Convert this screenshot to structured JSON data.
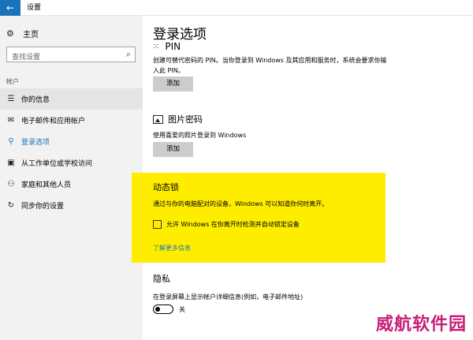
{
  "window": {
    "title": "设置"
  },
  "sidebar": {
    "home_label": "主页",
    "search_placeholder": "查找设置",
    "section_label": "帐户",
    "items": [
      {
        "label": "你的信息",
        "icon": "user-card-icon"
      },
      {
        "label": "电子邮件和应用帐户",
        "icon": "mail-icon"
      },
      {
        "label": "登录选项",
        "icon": "key-icon"
      },
      {
        "label": "从工作单位或学校访问",
        "icon": "briefcase-icon"
      },
      {
        "label": "家庭和其他人员",
        "icon": "person-icon"
      },
      {
        "label": "同步你的设置",
        "icon": "sync-icon"
      }
    ]
  },
  "main": {
    "title": "登录选项",
    "pin": {
      "heading": "PIN",
      "description": "创建可替代密码的 PIN。当你登录到 Windows 及其应用和服务时，系统会要求你输入此 PIN。",
      "button": "添加"
    },
    "picture_password": {
      "heading": "图片密码",
      "description": "使用喜爱的照片登录到 Windows",
      "button": "添加"
    },
    "dynamic_lock": {
      "heading": "动态锁",
      "description": "通过与你的电脑配对的设备，Windows 可以知道你何时离开。",
      "checkbox_label": "允许 Windows 在你离开时检测并自动锁定设备",
      "link": "了解更多信息",
      "highlight_color": "#ffed00"
    },
    "privacy": {
      "heading": "隐私",
      "description": "在登录屏幕上显示帐户详细信息(例如，电子邮件地址)",
      "toggle_state": "关"
    }
  },
  "watermark": "威航软件园",
  "colors": {
    "accent": "#1a73b8",
    "sidebar_bg": "#f2f2f2",
    "button_bg": "#cccccc",
    "watermark": "#c81e78"
  }
}
